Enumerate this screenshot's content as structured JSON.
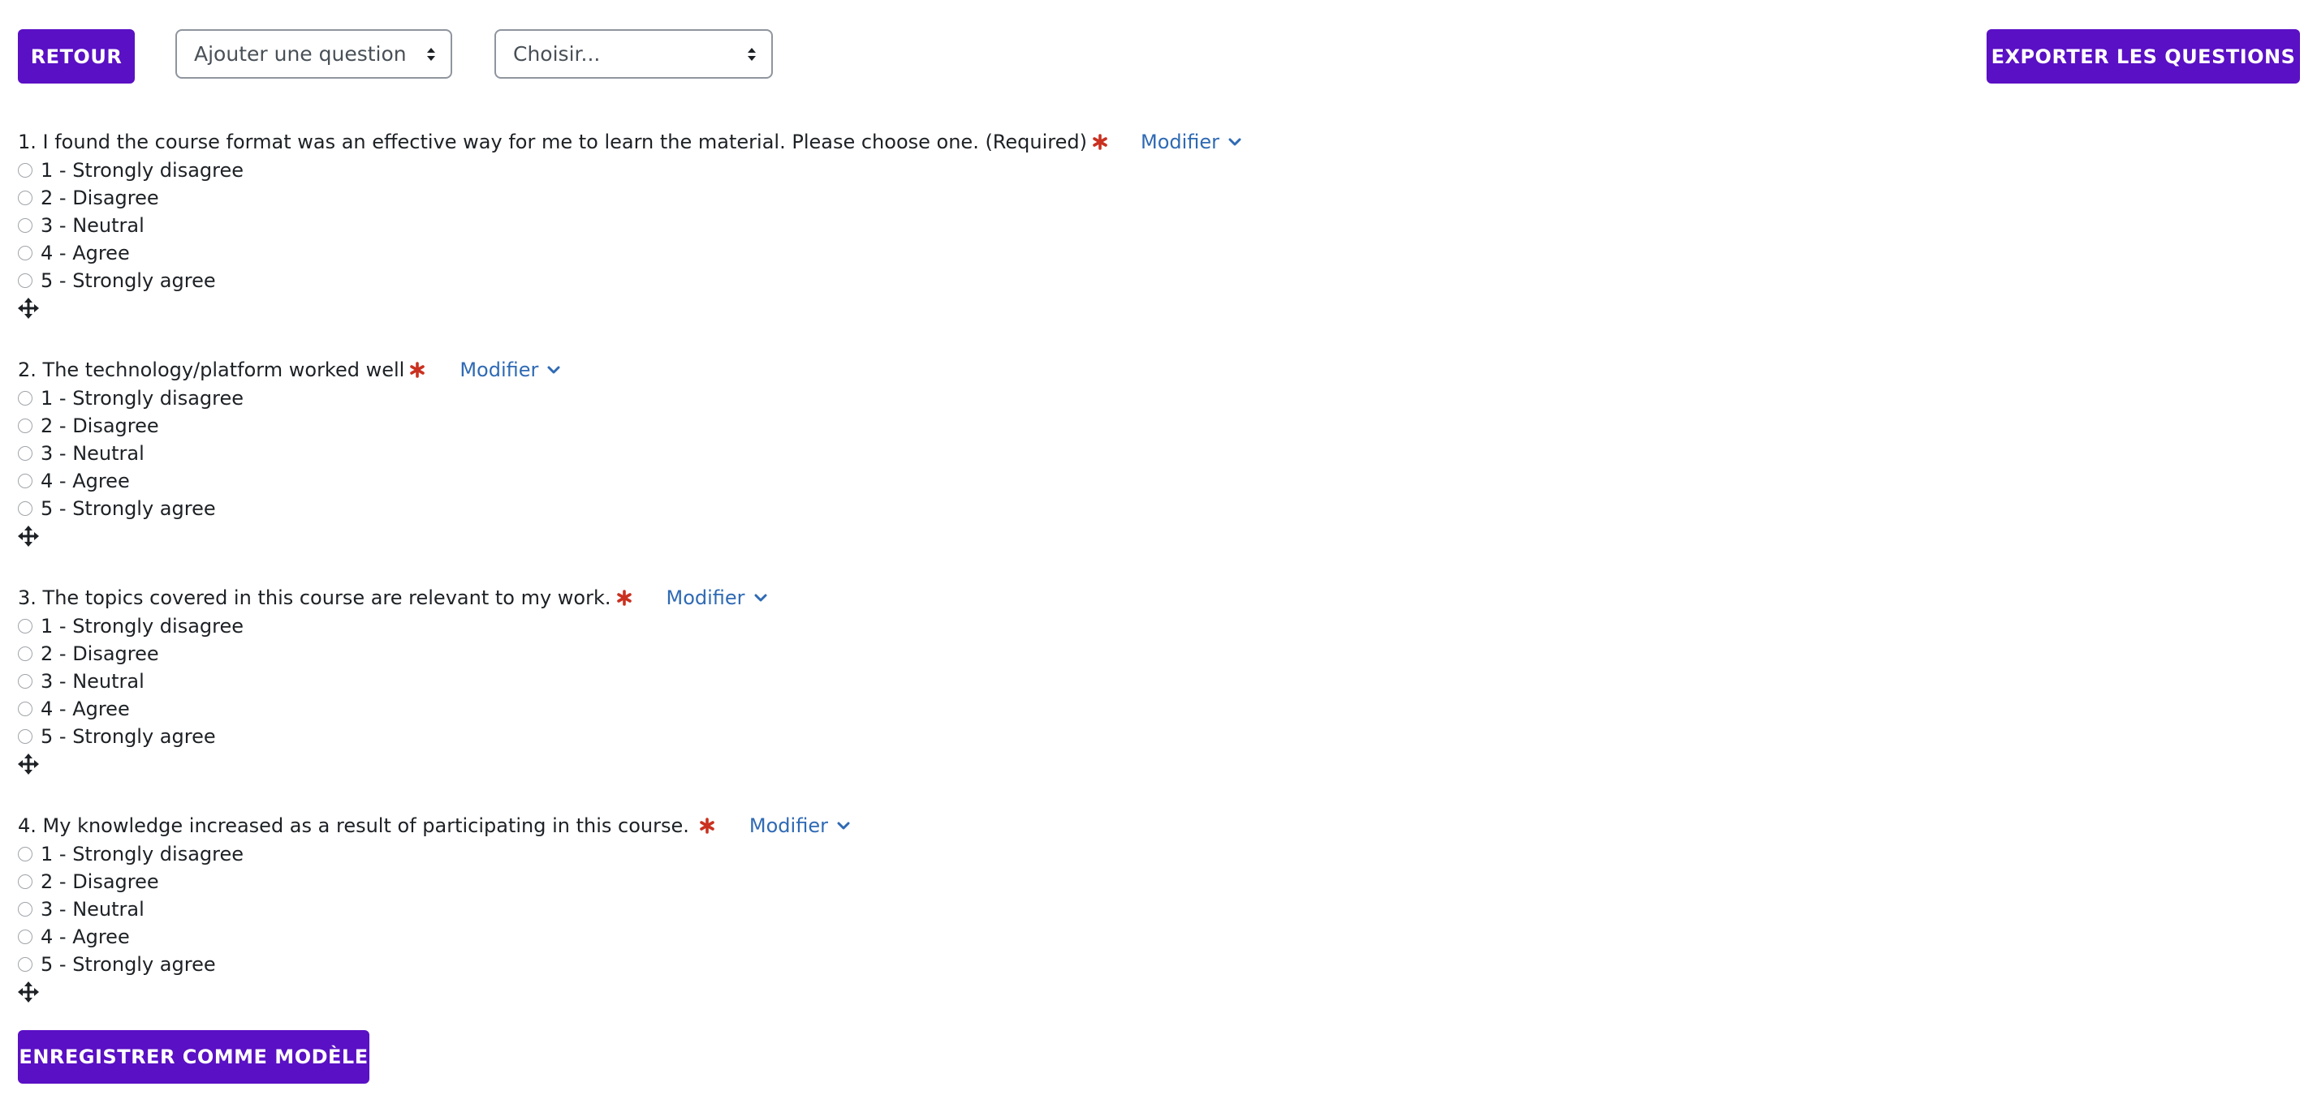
{
  "toolbar": {
    "back_label": "RETOUR",
    "add_question": "Ajouter une question",
    "choose": "Choisir...",
    "export_label": "EXPORTER LES QUESTIONS"
  },
  "questions": [
    {
      "title": "1. I found the course format was an effective way for me to learn the material. Please choose one. (Required)",
      "modify": "Modifier",
      "options": [
        "1 - Strongly disagree",
        "2 - Disagree",
        "3 - Neutral",
        "4 - Agree",
        "5 - Strongly agree"
      ]
    },
    {
      "title": "2. The technology/platform worked well",
      "modify": "Modifier",
      "options": [
        "1 - Strongly disagree",
        "2 - Disagree",
        "3 - Neutral",
        "4 - Agree",
        "5 - Strongly agree"
      ]
    },
    {
      "title": "3. The topics covered in this course are relevant to my work.",
      "modify": "Modifier",
      "options": [
        "1 - Strongly disagree",
        "2 - Disagree",
        "3 - Neutral",
        "4 - Agree",
        "5 - Strongly agree"
      ]
    },
    {
      "title": "4. My knowledge increased as a result of participating in this course.",
      "modify": "Modifier",
      "options": [
        "1 - Strongly disagree",
        "2 - Disagree",
        "3 - Neutral",
        "4 - Agree",
        "5 - Strongly agree"
      ]
    }
  ],
  "footer": {
    "save_label": "ENREGISTRER COMME MODÈLE"
  },
  "colors": {
    "primary": "#5a10c4",
    "required": "#ca3120",
    "link": "#2f6ab4"
  },
  "icons": {
    "required": "asterisk-icon",
    "modify_menu": "chevron-down-icon",
    "drag": "move-icon",
    "select": "select-caret-icon"
  }
}
